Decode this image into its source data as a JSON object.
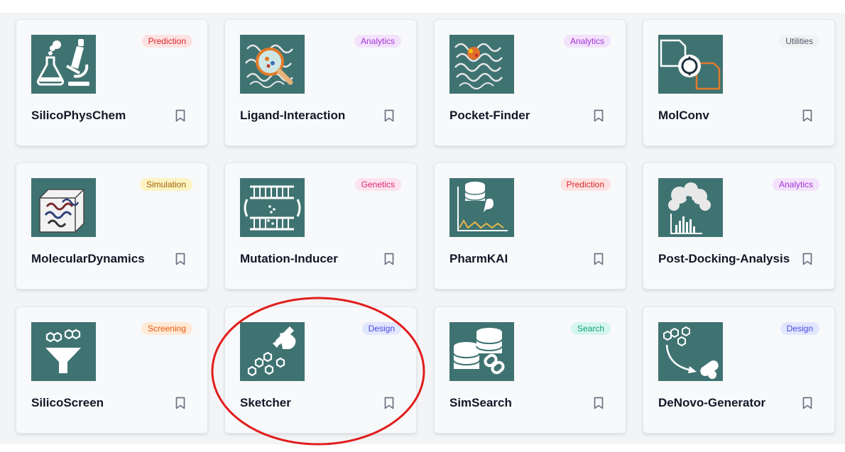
{
  "badge_colors": {
    "Prediction": {
      "bg": "#fde2e2",
      "fg": "#dc2626"
    },
    "Analytics": {
      "bg": "#f3e2fb",
      "fg": "#a533d8"
    },
    "Utilities": {
      "bg": "#f1f2f4",
      "fg": "#4b5563"
    },
    "Simulation": {
      "bg": "#fdf4c4",
      "fg": "#a16207"
    },
    "Genetics": {
      "bg": "#fce3ee",
      "fg": "#db2777"
    },
    "Screening": {
      "bg": "#feead7",
      "fg": "#ea580c"
    },
    "Design": {
      "bg": "#e1e7fd",
      "fg": "#4f46e5"
    },
    "Search": {
      "bg": "#d5f6ee",
      "fg": "#0f9f7a"
    }
  },
  "tools": [
    {
      "name": "SilicoPhysChem",
      "category": "Prediction",
      "icon": "flask-microscope-icon"
    },
    {
      "name": "Ligand-Interaction",
      "category": "Analytics",
      "icon": "protein-magnifier-icon"
    },
    {
      "name": "Pocket-Finder",
      "category": "Analytics",
      "icon": "protein-pocket-icon"
    },
    {
      "name": "MolConv",
      "category": "Utilities",
      "icon": "file-convert-icon"
    },
    {
      "name": "MolecularDynamics",
      "category": "Simulation",
      "icon": "protein-box-icon"
    },
    {
      "name": "Mutation-Inducer",
      "category": "Genetics",
      "icon": "dna-mutation-icon"
    },
    {
      "name": "PharmKAI",
      "category": "Prediction",
      "icon": "database-pk-curve-icon"
    },
    {
      "name": "Post-Docking-Analysis",
      "category": "Analytics",
      "icon": "protein-histogram-icon"
    },
    {
      "name": "SilicoScreen",
      "category": "Screening",
      "icon": "molecule-funnel-icon"
    },
    {
      "name": "Sketcher",
      "category": "Design",
      "icon": "hand-pen-molecules-icon"
    },
    {
      "name": "SimSearch",
      "category": "Search",
      "icon": "database-link-icon"
    },
    {
      "name": "DeNovo-Generator",
      "category": "Design",
      "icon": "molecule-to-pill-icon"
    }
  ],
  "annotation": {
    "color": "#e11d1d",
    "target": "Sketcher"
  }
}
